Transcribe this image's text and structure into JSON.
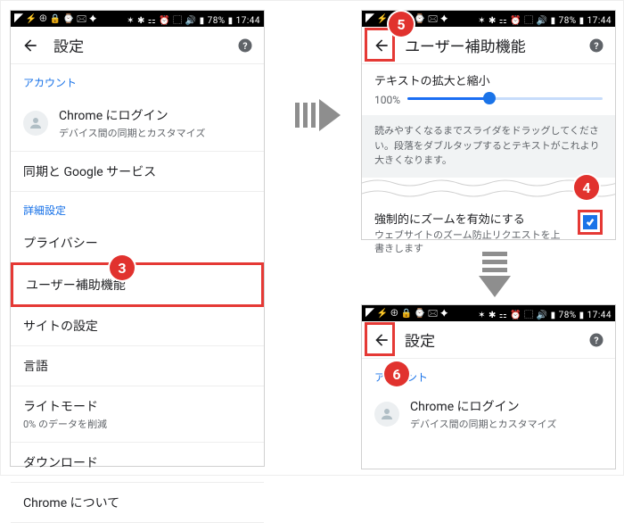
{
  "status": {
    "left": "◤ ⚡ ⊕ 🔒 ⌚ 🖂 ✦",
    "right": "✶ ✱ ⚏ ⏰ ⬚ 🔊 ▮ 78% ▮ 17:44"
  },
  "left": {
    "title": "設定",
    "accountLabel": "アカウント",
    "login": {
      "title": "Chrome にログイン",
      "sub": "デバイス間の同期とカスタマイズ"
    },
    "rows": {
      "sync": "同期と Google サービス",
      "advanced": "詳細設定",
      "privacy": "プライバシー",
      "accessibility": "ユーザー補助機能",
      "sites": "サイトの設定",
      "language": "言語",
      "lightMode": {
        "title": "ライトモード",
        "sub": "0% のデータを削減"
      },
      "downloads": "ダウンロード",
      "about": "Chrome について"
    }
  },
  "rt": {
    "title": "ユーザー補助機能",
    "slider": {
      "title": "テキストの拡大と縮小",
      "value": "100%"
    },
    "note": "読みやすくなるまでスライダをドラッグしてください。段落をダブルタップするとテキストがこれより大きくなります。",
    "zoom": {
      "title": "強制的にズームを有効にする",
      "sub": "ウェブサイトのズーム防止リクエストを上書きします"
    }
  },
  "rb": {
    "title": "設定",
    "accountLabel": "アカウント",
    "login": {
      "title": "Chrome にログイン",
      "sub": "デバイス間の同期とカスタマイズ"
    }
  },
  "steps": {
    "s3": "3",
    "s4": "4",
    "s5": "5",
    "s6": "6"
  }
}
